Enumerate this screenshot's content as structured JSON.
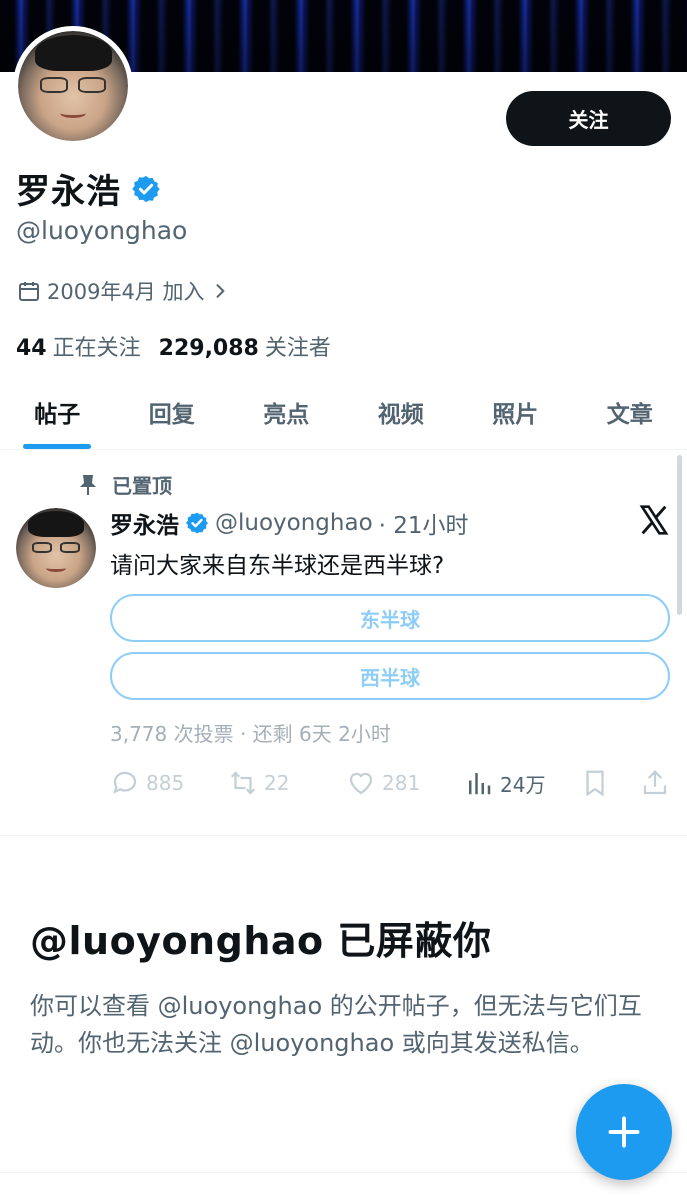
{
  "profile": {
    "follow_label": "关注",
    "name": "罗永浩",
    "handle": "@luoyonghao",
    "joined": "2009年4月 加入",
    "following_count": "44",
    "following_label": "正在关注",
    "followers_count": "229,088",
    "followers_label": "关注者"
  },
  "tabs": [
    "帖子",
    "回复",
    "亮点",
    "视频",
    "照片",
    "文章"
  ],
  "pinned_post": {
    "pinned_label": "已置顶",
    "author": "罗永浩",
    "handle": "@luoyonghao",
    "time": "· 21小时",
    "text": "请问大家来自东半球还是西半球?",
    "poll_options": [
      "东半球",
      "西半球"
    ],
    "poll_meta": "3,778 次投票 · 还剩 6天 2小时",
    "replies": "885",
    "reposts": "22",
    "likes": "281",
    "views": "24万"
  },
  "blocked": {
    "title": "@luoyonghao 已屏蔽你",
    "description": "你可以查看 @luoyonghao 的公开帖子，但无法与它们互动。你也无法关注 @luoyonghao 或向其发送私信。"
  },
  "colors": {
    "accent": "#1d9bf0",
    "text": "#0f1419",
    "muted": "#536471"
  },
  "icons": [
    "calendar-icon",
    "chevron-right-icon",
    "verified-badge-icon",
    "pin-icon",
    "x-logo-icon",
    "reply-icon",
    "repost-icon",
    "like-icon",
    "views-icon",
    "bookmark-icon",
    "share-icon",
    "plus-icon"
  ]
}
